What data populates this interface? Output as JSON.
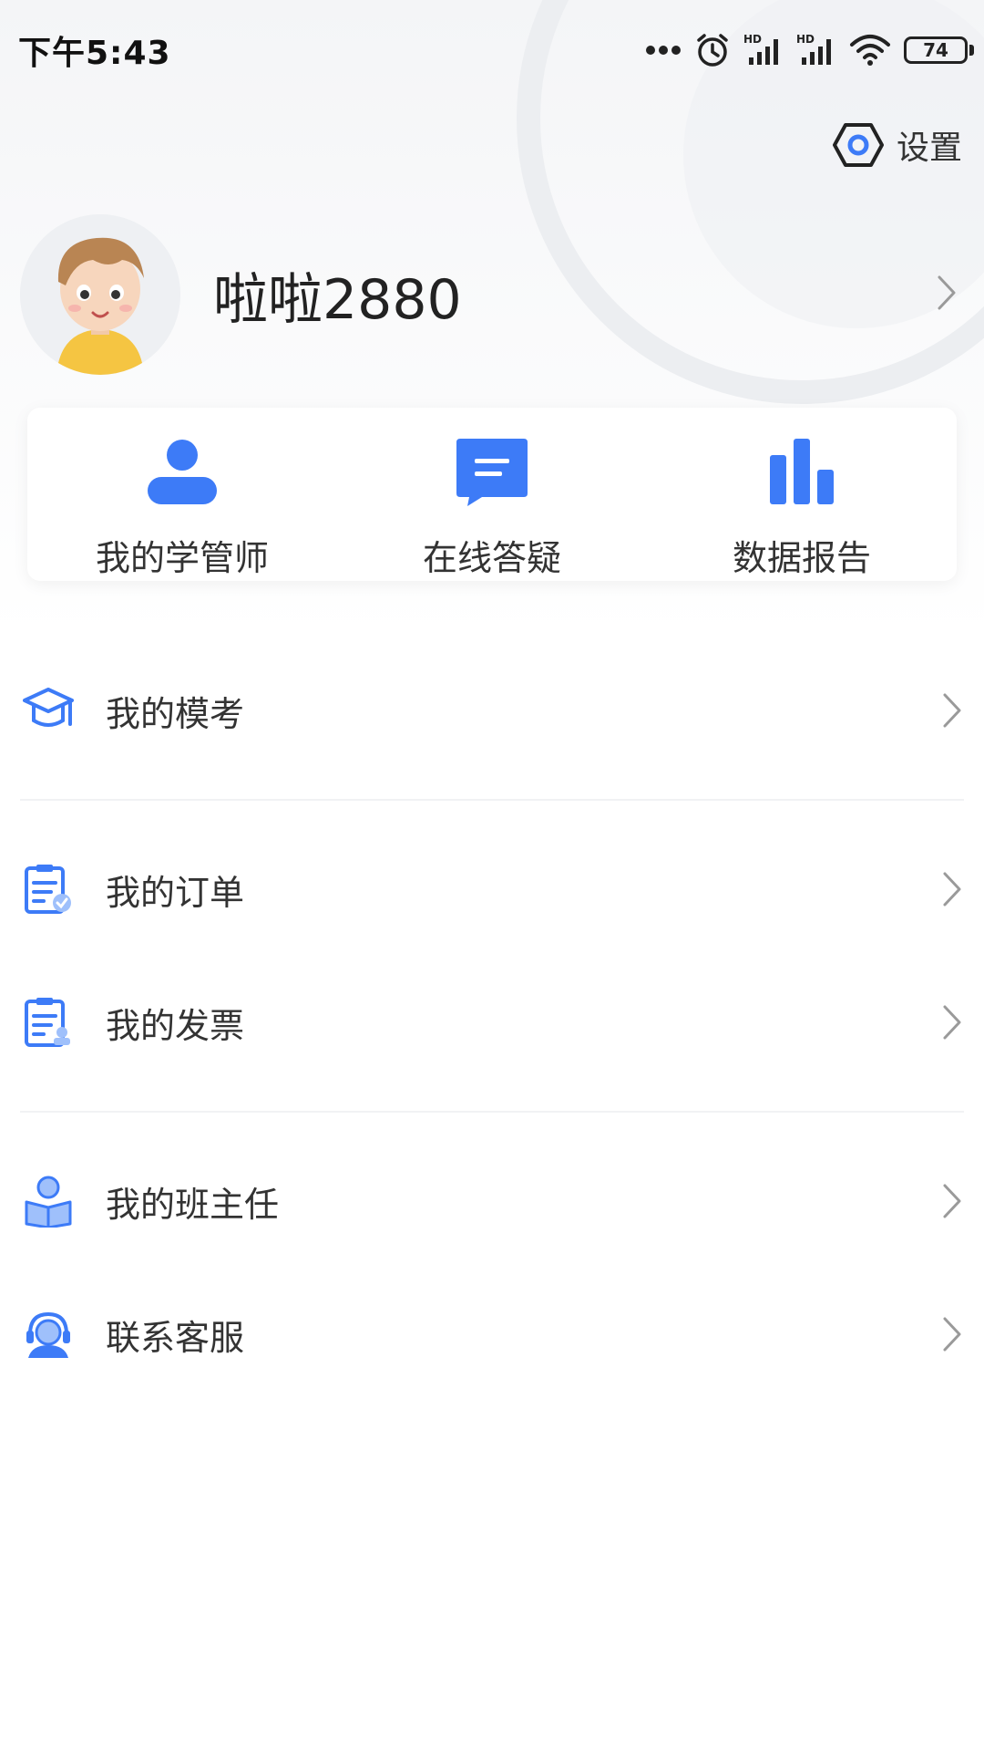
{
  "status_bar": {
    "time": "下午5:43",
    "battery_level": "74",
    "icons": [
      "more-dots-icon",
      "alarm-icon",
      "hd-signal-icon",
      "hd-signal-icon",
      "wifi-icon",
      "battery-icon"
    ]
  },
  "settings": {
    "label": "设置",
    "icon": "settings-hex-icon"
  },
  "profile": {
    "username": "啦啦2880",
    "avatar": "cartoon-boy-avatar"
  },
  "quick_actions": [
    {
      "label": "我的学管师",
      "icon": "person-icon"
    },
    {
      "label": "在线答疑",
      "icon": "chat-icon"
    },
    {
      "label": "数据报告",
      "icon": "bar-chart-icon"
    }
  ],
  "menu": [
    {
      "label": "我的模考",
      "icon": "graduation-cap-icon"
    },
    {
      "label": "我的订单",
      "icon": "order-icon"
    },
    {
      "label": "我的发票",
      "icon": "invoice-icon"
    },
    {
      "label": "我的班主任",
      "icon": "teacher-icon"
    },
    {
      "label": "联系客服",
      "icon": "customer-service-icon"
    }
  ],
  "colors": {
    "accent": "#3d7bf7",
    "text": "#333333",
    "divider": "#f1f2f4"
  }
}
